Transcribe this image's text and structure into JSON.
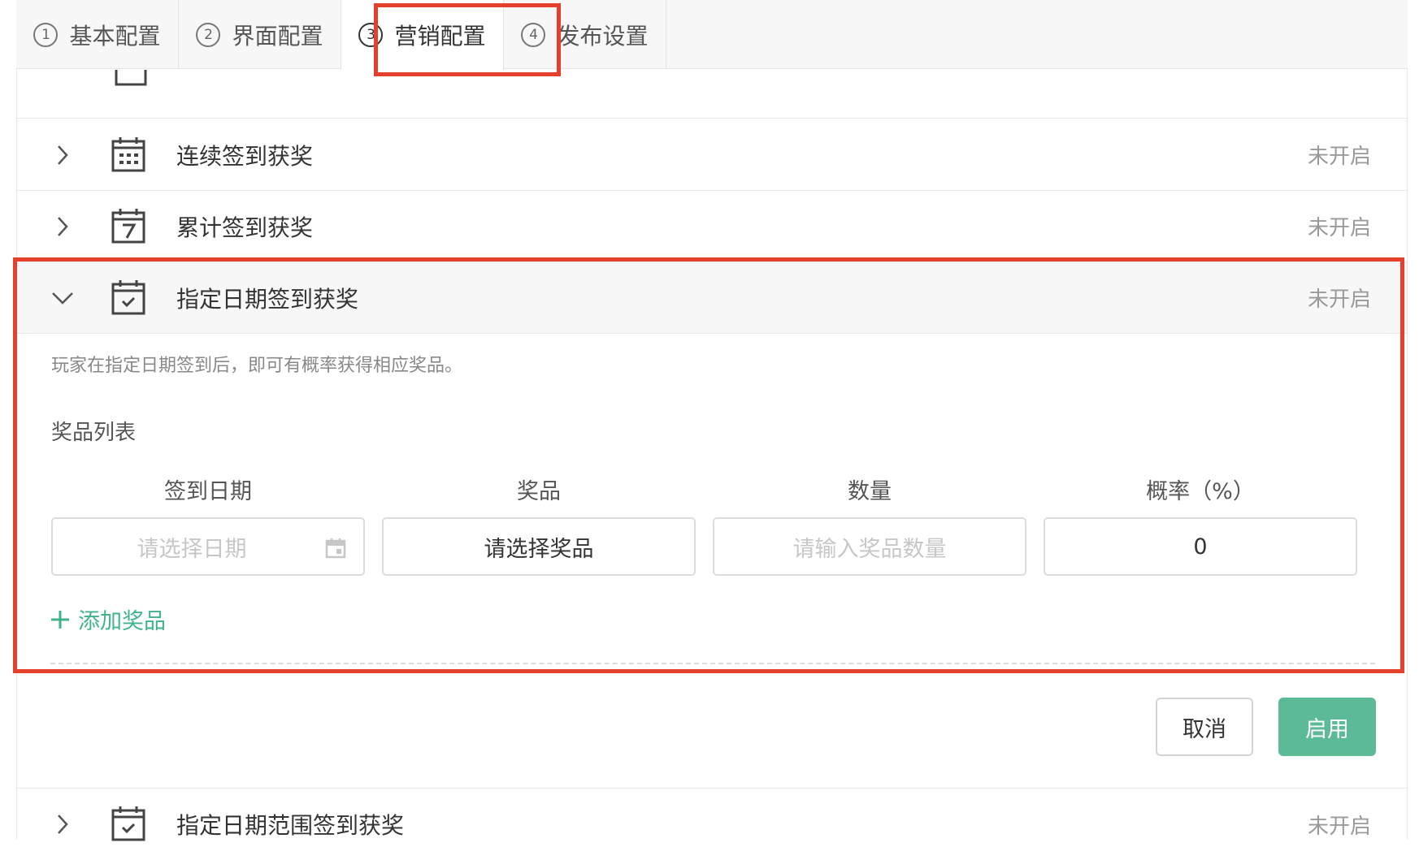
{
  "tabs": [
    {
      "num": "1",
      "label": "基本配置"
    },
    {
      "num": "2",
      "label": "界面配置"
    },
    {
      "num": "3",
      "label": "营销配置"
    },
    {
      "num": "4",
      "label": "发布设置"
    }
  ],
  "active_tab": 2,
  "rows": [
    {
      "title": "连续签到获奖",
      "status": "未开启",
      "icon": "calendar-grid-icon"
    },
    {
      "title": "累计签到获奖",
      "status": "未开启",
      "icon": "calendar-7-icon"
    },
    {
      "title": "指定日期签到获奖",
      "status": "未开启",
      "icon": "calendar-check-icon"
    },
    {
      "title": "指定日期范围签到获奖",
      "status": "未开启",
      "icon": "calendar-check-icon"
    }
  ],
  "panel": {
    "description": "玩家在指定日期签到后，即可有概率获得相应奖品。",
    "prize_list_label": "奖品列表",
    "columns": [
      "签到日期",
      "奖品",
      "数量",
      "概率（%）"
    ],
    "date_placeholder": "请选择日期",
    "prize_select_label": "请选择奖品",
    "quantity_placeholder": "请输入奖品数量",
    "probability_value": "0",
    "add_prize_label": "添加奖品",
    "cancel_label": "取消",
    "enable_label": "启用"
  },
  "colors": {
    "accent_green": "#5cbb96",
    "link_green": "#41b38a",
    "highlight_red": "#e5402b",
    "status_gray": "#9a9a9a"
  }
}
